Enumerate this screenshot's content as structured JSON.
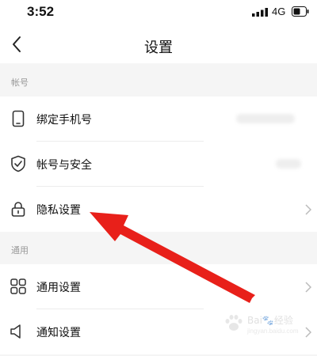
{
  "status_bar": {
    "time": "3:52",
    "network": "4G"
  },
  "header": {
    "title": "设置"
  },
  "sections": [
    {
      "label": "帐号",
      "items": [
        {
          "label": "绑定手机号",
          "icon": "phone-icon"
        },
        {
          "label": "帐号与安全",
          "icon": "shield-icon"
        },
        {
          "label": "隐私设置",
          "icon": "lock-icon"
        }
      ]
    },
    {
      "label": "通用",
      "items": [
        {
          "label": "通用设置",
          "icon": "grid-icon"
        },
        {
          "label": "通知设置",
          "icon": "speaker-icon"
        }
      ]
    }
  ],
  "annotation": {
    "arrow_color": "#e8201a",
    "points_to": "隐私设置"
  },
  "watermark": {
    "text": "Bai🐾经验",
    "sub": "jingyan.baidu.com"
  }
}
